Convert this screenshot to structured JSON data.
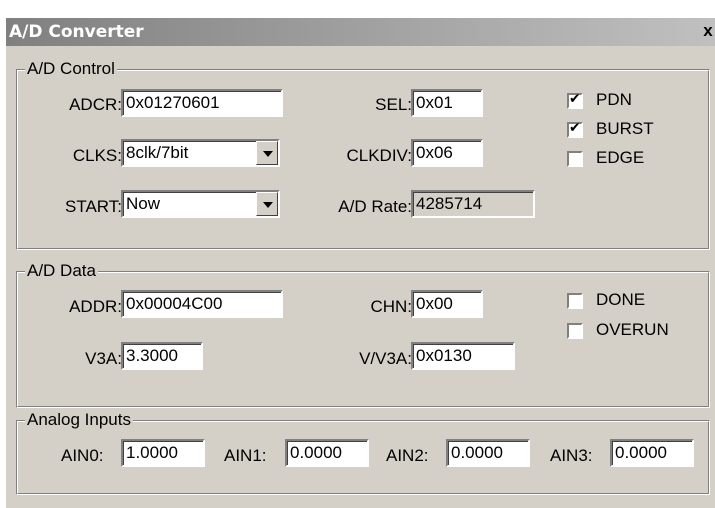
{
  "window": {
    "title": "A/D Converter",
    "close": "x"
  },
  "control": {
    "legend": "A/D Control",
    "adcr_label": "ADCR:",
    "adcr_value": "0x01270601",
    "sel_label": "SEL:",
    "sel_value": "0x01",
    "clks_label": "CLKS:",
    "clks_value": "8clk/7bit",
    "clkdiv_label": "CLKDIV:",
    "clkdiv_value": "0x06",
    "start_label": "START:",
    "start_value": "Now",
    "rate_label": "A/D Rate:",
    "rate_value": "4285714",
    "pdn": {
      "label": "PDN",
      "checked": true
    },
    "burst": {
      "label": "BURST",
      "checked": true
    },
    "edge": {
      "label": "EDGE",
      "checked": false
    }
  },
  "data": {
    "legend": "A/D Data",
    "addr_label": "ADDR:",
    "addr_value": "0x00004C00",
    "chn_label": "CHN:",
    "chn_value": "0x00",
    "v3a_label": "V3A:",
    "v3a_value": "3.3000",
    "vv3a_label": "V/V3A:",
    "vv3a_value": "0x0130",
    "done": {
      "label": "DONE",
      "checked": false
    },
    "overun": {
      "label": "OVERUN",
      "checked": false
    }
  },
  "analog": {
    "legend": "Analog Inputs",
    "ain0_label": "AIN0:",
    "ain0_value": "1.0000",
    "ain1_label": "AIN1:",
    "ain1_value": "0.0000",
    "ain2_label": "AIN2:",
    "ain2_value": "0.0000",
    "ain3_label": "AIN3:",
    "ain3_value": "0.0000"
  }
}
